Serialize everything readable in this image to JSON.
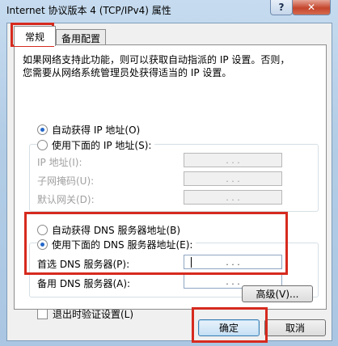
{
  "window": {
    "title": "Internet 协议版本 4 (TCP/IPv4) 属性",
    "help_label": "?",
    "close_label": "✕"
  },
  "tabs": [
    {
      "label": "常规",
      "active": true
    },
    {
      "label": "备用配置",
      "active": false
    }
  ],
  "description": {
    "line1": "如果网络支持此功能，则可以获取自动指派的 IP 设置。否则，",
    "line2": "您需要从网络系统管理员处获得适当的 IP 设置。"
  },
  "ip_section": {
    "auto_label": "自动获得 IP 地址(O)",
    "auto_selected": true,
    "manual_label": "使用下面的 IP 地址(S):",
    "manual_selected": false,
    "fields": [
      {
        "label": "IP 地址(I):",
        "value": ". . ."
      },
      {
        "label": "子网掩码(U):",
        "value": ". . ."
      },
      {
        "label": "默认网关(D):",
        "value": ". . ."
      }
    ]
  },
  "dns_section": {
    "auto_label": "自动获得 DNS 服务器地址(B)",
    "auto_selected": false,
    "manual_label": "使用下面的 DNS 服务器地址(E):",
    "manual_selected": true,
    "fields": [
      {
        "label": "首选 DNS 服务器(P):",
        "value": ". . ."
      },
      {
        "label": "备用 DNS 服务器(A):",
        "value": ". . ."
      }
    ]
  },
  "validate": {
    "label": "退出时验证设置(L)",
    "checked": false
  },
  "buttons": {
    "advanced": "高级(V)...",
    "ok": "确定",
    "cancel": "取消"
  },
  "colors": {
    "highlight": "#d62a1e",
    "radio_dot": "#2467c9"
  }
}
